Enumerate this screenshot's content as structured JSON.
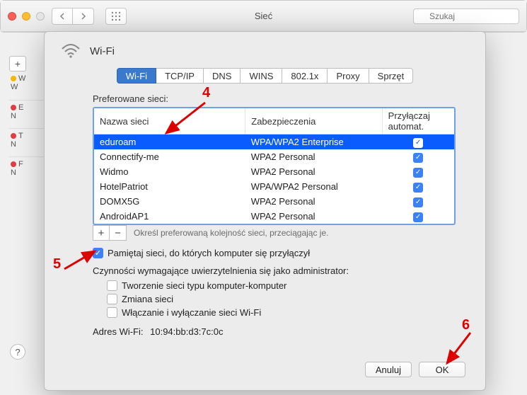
{
  "window": {
    "title": "Sieć",
    "search_placeholder": "Szukaj"
  },
  "sidebar": {
    "items": [
      {
        "label": "W",
        "sub": "W",
        "status": "g"
      },
      {
        "label": "E",
        "sub": "N",
        "status": "r"
      },
      {
        "label": "T",
        "sub": "N",
        "status": "r"
      },
      {
        "label": "F",
        "sub": "N",
        "status": "r"
      }
    ]
  },
  "sheet": {
    "title": "Wi-Fi",
    "tabs": [
      "Wi-Fi",
      "TCP/IP",
      "DNS",
      "WINS",
      "802.1x",
      "Proxy",
      "Sprzęt"
    ],
    "active_tab": 0,
    "preferred_label": "Preferowane sieci:",
    "columns": [
      "Nazwa sieci",
      "Zabezpieczenia",
      "Przyłączaj automat."
    ],
    "networks": [
      {
        "name": "eduroam",
        "security": "WPA/WPA2 Enterprise",
        "auto": true,
        "selected": true
      },
      {
        "name": "Connectify-me",
        "security": "WPA2 Personal",
        "auto": true,
        "selected": false
      },
      {
        "name": "Widmo",
        "security": "WPA2 Personal",
        "auto": true,
        "selected": false
      },
      {
        "name": "HotelPatriot",
        "security": "WPA/WPA2 Personal",
        "auto": true,
        "selected": false
      },
      {
        "name": "DOMX5G",
        "security": "WPA2 Personal",
        "auto": true,
        "selected": false
      },
      {
        "name": "AndroidAP1",
        "security": "WPA2 Personal",
        "auto": true,
        "selected": false
      }
    ],
    "drag_hint": "Określ preferowaną kolejność sieci, przeciągając je.",
    "remember_label": "Pamiętaj sieci, do których komputer się przyłączył",
    "remember_checked": true,
    "admin_label": "Czynności wymagające uwierzytelnienia się jako administrator:",
    "admin_opts": [
      {
        "label": "Tworzenie sieci typu komputer-komputer",
        "checked": false
      },
      {
        "label": "Zmiana sieci",
        "checked": false
      },
      {
        "label": "Włączanie i wyłączanie sieci Wi-Fi",
        "checked": false
      }
    ],
    "mac_label": "Adres Wi-Fi:",
    "mac_value": "10:94:bb:d3:7c:0c",
    "cancel": "Anuluj",
    "ok": "OK"
  },
  "annotations": {
    "n4": "4",
    "n5": "5",
    "n6": "6"
  }
}
